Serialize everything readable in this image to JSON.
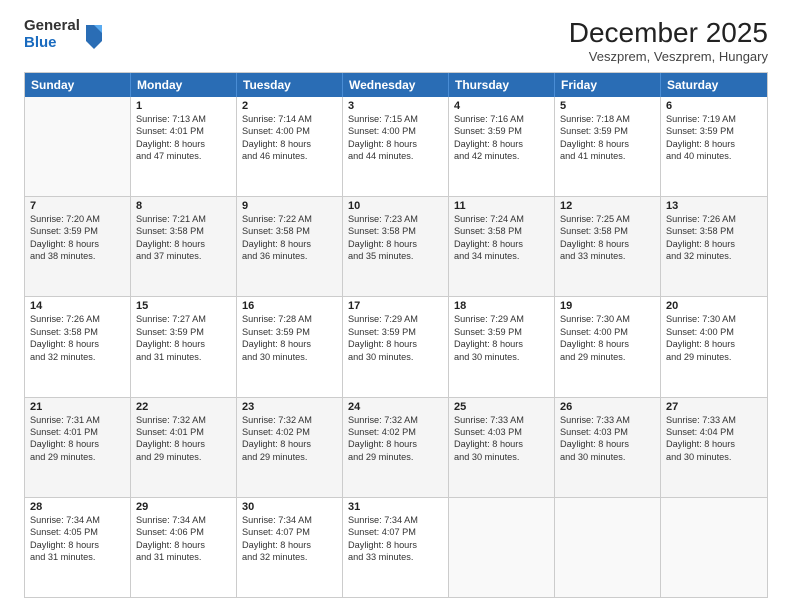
{
  "header": {
    "logo_general": "General",
    "logo_blue": "Blue",
    "month_title": "December 2025",
    "location": "Veszprem, Veszprem, Hungary"
  },
  "weekdays": [
    "Sunday",
    "Monday",
    "Tuesday",
    "Wednesday",
    "Thursday",
    "Friday",
    "Saturday"
  ],
  "rows": [
    {
      "shade": "white",
      "cells": [
        {
          "empty": true
        },
        {
          "day": 1,
          "sunrise": "7:13 AM",
          "sunset": "4:01 PM",
          "daylight": "8 hours and 47 minutes."
        },
        {
          "day": 2,
          "sunrise": "7:14 AM",
          "sunset": "4:00 PM",
          "daylight": "8 hours and 46 minutes."
        },
        {
          "day": 3,
          "sunrise": "7:15 AM",
          "sunset": "4:00 PM",
          "daylight": "8 hours and 44 minutes."
        },
        {
          "day": 4,
          "sunrise": "7:16 AM",
          "sunset": "3:59 PM",
          "daylight": "8 hours and 42 minutes."
        },
        {
          "day": 5,
          "sunrise": "7:18 AM",
          "sunset": "3:59 PM",
          "daylight": "8 hours and 41 minutes."
        },
        {
          "day": 6,
          "sunrise": "7:19 AM",
          "sunset": "3:59 PM",
          "daylight": "8 hours and 40 minutes."
        }
      ]
    },
    {
      "shade": "grey",
      "cells": [
        {
          "day": 7,
          "sunrise": "7:20 AM",
          "sunset": "3:59 PM",
          "daylight": "8 hours and 38 minutes."
        },
        {
          "day": 8,
          "sunrise": "7:21 AM",
          "sunset": "3:58 PM",
          "daylight": "8 hours and 37 minutes."
        },
        {
          "day": 9,
          "sunrise": "7:22 AM",
          "sunset": "3:58 PM",
          "daylight": "8 hours and 36 minutes."
        },
        {
          "day": 10,
          "sunrise": "7:23 AM",
          "sunset": "3:58 PM",
          "daylight": "8 hours and 35 minutes."
        },
        {
          "day": 11,
          "sunrise": "7:24 AM",
          "sunset": "3:58 PM",
          "daylight": "8 hours and 34 minutes."
        },
        {
          "day": 12,
          "sunrise": "7:25 AM",
          "sunset": "3:58 PM",
          "daylight": "8 hours and 33 minutes."
        },
        {
          "day": 13,
          "sunrise": "7:26 AM",
          "sunset": "3:58 PM",
          "daylight": "8 hours and 32 minutes."
        }
      ]
    },
    {
      "shade": "white",
      "cells": [
        {
          "day": 14,
          "sunrise": "7:26 AM",
          "sunset": "3:58 PM",
          "daylight": "8 hours and 32 minutes."
        },
        {
          "day": 15,
          "sunrise": "7:27 AM",
          "sunset": "3:59 PM",
          "daylight": "8 hours and 31 minutes."
        },
        {
          "day": 16,
          "sunrise": "7:28 AM",
          "sunset": "3:59 PM",
          "daylight": "8 hours and 30 minutes."
        },
        {
          "day": 17,
          "sunrise": "7:29 AM",
          "sunset": "3:59 PM",
          "daylight": "8 hours and 30 minutes."
        },
        {
          "day": 18,
          "sunrise": "7:29 AM",
          "sunset": "3:59 PM",
          "daylight": "8 hours and 30 minutes."
        },
        {
          "day": 19,
          "sunrise": "7:30 AM",
          "sunset": "4:00 PM",
          "daylight": "8 hours and 29 minutes."
        },
        {
          "day": 20,
          "sunrise": "7:30 AM",
          "sunset": "4:00 PM",
          "daylight": "8 hours and 29 minutes."
        }
      ]
    },
    {
      "shade": "grey",
      "cells": [
        {
          "day": 21,
          "sunrise": "7:31 AM",
          "sunset": "4:01 PM",
          "daylight": "8 hours and 29 minutes."
        },
        {
          "day": 22,
          "sunrise": "7:32 AM",
          "sunset": "4:01 PM",
          "daylight": "8 hours and 29 minutes."
        },
        {
          "day": 23,
          "sunrise": "7:32 AM",
          "sunset": "4:02 PM",
          "daylight": "8 hours and 29 minutes."
        },
        {
          "day": 24,
          "sunrise": "7:32 AM",
          "sunset": "4:02 PM",
          "daylight": "8 hours and 29 minutes."
        },
        {
          "day": 25,
          "sunrise": "7:33 AM",
          "sunset": "4:03 PM",
          "daylight": "8 hours and 30 minutes."
        },
        {
          "day": 26,
          "sunrise": "7:33 AM",
          "sunset": "4:03 PM",
          "daylight": "8 hours and 30 minutes."
        },
        {
          "day": 27,
          "sunrise": "7:33 AM",
          "sunset": "4:04 PM",
          "daylight": "8 hours and 30 minutes."
        }
      ]
    },
    {
      "shade": "white",
      "cells": [
        {
          "day": 28,
          "sunrise": "7:34 AM",
          "sunset": "4:05 PM",
          "daylight": "8 hours and 31 minutes."
        },
        {
          "day": 29,
          "sunrise": "7:34 AM",
          "sunset": "4:06 PM",
          "daylight": "8 hours and 31 minutes."
        },
        {
          "day": 30,
          "sunrise": "7:34 AM",
          "sunset": "4:07 PM",
          "daylight": "8 hours and 32 minutes."
        },
        {
          "day": 31,
          "sunrise": "7:34 AM",
          "sunset": "4:07 PM",
          "daylight": "8 hours and 33 minutes."
        },
        {
          "empty": true
        },
        {
          "empty": true
        },
        {
          "empty": true
        }
      ]
    }
  ]
}
